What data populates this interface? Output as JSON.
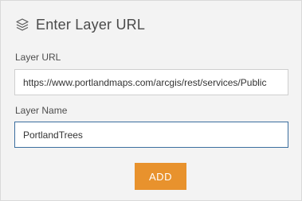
{
  "header": {
    "icon": "layers-icon",
    "title": "Enter Layer URL"
  },
  "form": {
    "url_label": "Layer URL",
    "url_value": "https://www.portlandmaps.com/arcgis/rest/services/Public",
    "name_label": "Layer Name",
    "name_value": "PortlandTrees"
  },
  "actions": {
    "add_label": "ADD"
  },
  "colors": {
    "accent_button": "#e8922d",
    "focused_border": "#3b6e9e"
  }
}
